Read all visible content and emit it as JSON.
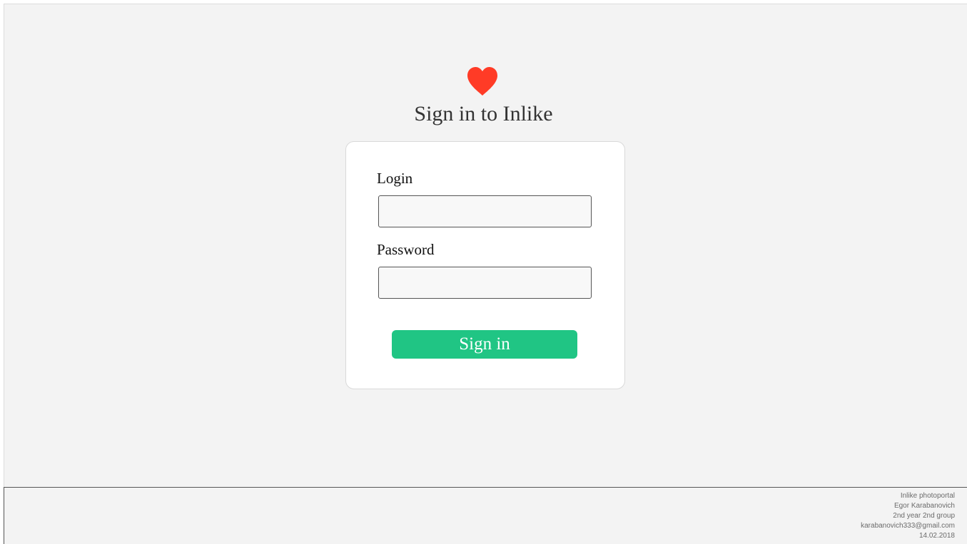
{
  "brand": {
    "logo_icon": "heart-icon",
    "logo_color": "#ff3b26"
  },
  "page_title": "Sign in to Inlike",
  "form": {
    "login_label": "Login",
    "login_value": "",
    "password_label": "Password",
    "password_value": "",
    "submit_label": "Sign in",
    "submit_color": "#20c584"
  },
  "footer": {
    "lines": [
      "Inlike photoportal",
      "Egor Karabanovich",
      "2nd year 2nd group",
      "karabanovich333@gmail.com",
      "14.02.2018"
    ]
  }
}
